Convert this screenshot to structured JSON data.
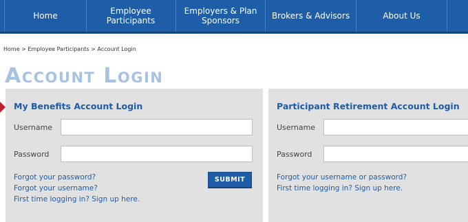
{
  "nav": {
    "items": [
      {
        "label": "Home"
      },
      {
        "label": "Employee\nParticipants"
      },
      {
        "label": "Employers & Plan\nSponsors"
      },
      {
        "label": "Brokers & Advisors"
      },
      {
        "label": "About Us"
      }
    ]
  },
  "breadcrumb": "Home > Employee Participants > Account Login",
  "page_title": "Account Login",
  "benefits_panel": {
    "title": "My Benefits Account Login",
    "username_label": "Username",
    "username_value": "",
    "password_label": "Password",
    "password_value": "",
    "submit_label": "SUBMIT",
    "links": [
      "Forgot your password?",
      "Forgot your username?",
      "First time logging in? Sign up here."
    ]
  },
  "retirement_panel": {
    "title": "Participant Retirement Account Login",
    "username_label": "Username",
    "username_value": "",
    "password_label": "Password",
    "password_value": "",
    "links": [
      "Forgot your username or password?",
      "First time logging in? Sign up here."
    ]
  },
  "colors": {
    "nav_background": "#1e5ea8",
    "accent": "#1f5ca6",
    "title_color": "#a7c3e2",
    "panel_background": "#e1e1e1",
    "arrow": "#c0212b"
  },
  "icons": [
    "arrow-pointer-icon"
  ]
}
